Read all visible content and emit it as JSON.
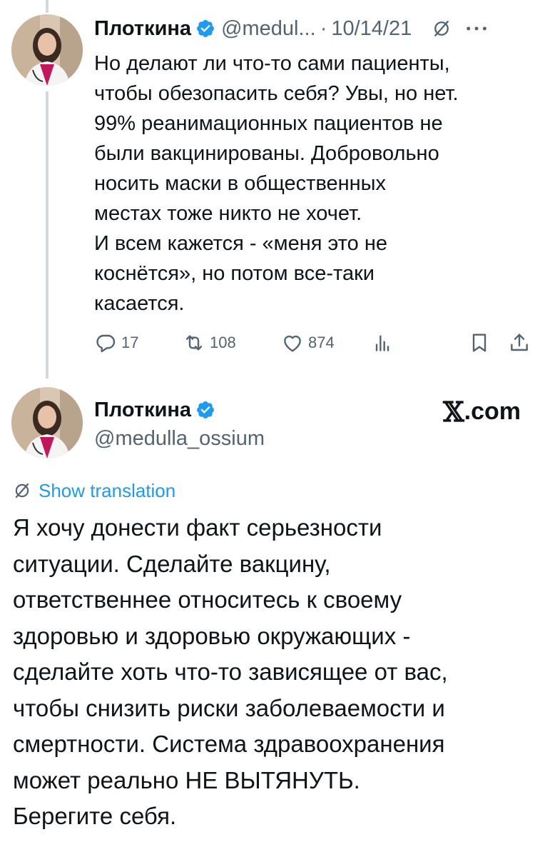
{
  "thread_tweet": {
    "author_name": "Плоткина",
    "handle": "@medul...",
    "separator": "·",
    "date": "10/14/21",
    "body_lines": [
      "Но делают ли что-то сами пациенты,",
      "чтобы обезопасить себя? Увы, но нет.",
      "99% реанимационных пациентов не",
      "были вакцинированы. Добровольно",
      "носить маски в общественных",
      "местах тоже никто не хочет.",
      "И всем кажется - «меня это не",
      "коснётся», но потом все-таки",
      "касается."
    ],
    "metrics": {
      "replies": "17",
      "reposts": "108",
      "likes": "874"
    },
    "icons": [
      "verified-badge-icon",
      "grok-icon",
      "more-icon",
      "reply-icon",
      "repost-icon",
      "like-icon",
      "views-icon",
      "bookmark-icon",
      "share-icon"
    ]
  },
  "main_tweet": {
    "author_name": "Плоткина",
    "handle": "@medulla_ossium",
    "brand": {
      "mark": "𝕏",
      "text": ".com"
    },
    "show_translation": "Show translation",
    "body_lines": [
      "Я хочу донести факт серьезности",
      "ситуации. Сделайте вакцину,",
      "ответственнее относитесь к своему",
      "здоровью и здоровью окружающих -",
      "сделайте хоть что-то зависящее от вас,",
      "чтобы снизить риски заболеваемости и",
      "смертности. Система здравоохранения",
      "может реально НЕ ВЫТЯНУТЬ.",
      "Берегите себя."
    ]
  },
  "colors": {
    "text": "#0f1419",
    "secondary": "#536471",
    "accent": "#1d9bf0",
    "thread_line": "#cfd9de"
  }
}
